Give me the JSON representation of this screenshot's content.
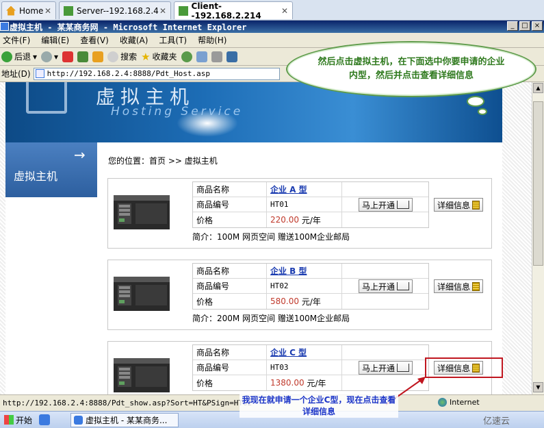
{
  "vm_tabs": [
    {
      "label": "Home",
      "active": false
    },
    {
      "label": "Server--192.168.2.4",
      "active": false
    },
    {
      "label": "Client--192.168.2.214",
      "active": true
    }
  ],
  "window": {
    "title": "虚拟主机 - 某某商务网 - Microsoft Internet Explorer",
    "buttons": [
      "_",
      "□",
      "×"
    ]
  },
  "menu": [
    "文件(F)",
    "编辑(E)",
    "查看(V)",
    "收藏(A)",
    "工具(T)",
    "帮助(H)"
  ],
  "toolbar": {
    "back": "后退",
    "search": "搜索",
    "favorites": "收藏夹"
  },
  "address": {
    "label": "地址(D)",
    "url": "http://192.168.2.4:8888/Pdt_Host.asp"
  },
  "banner": {
    "cn": "虚拟主机",
    "en": "Hosting Service"
  },
  "leftnav": {
    "arrow": "→",
    "label": "虚拟主机"
  },
  "breadcrumb": "您的位置：首页 >> 虚拟主机",
  "products": [
    {
      "k_name": "商品名称",
      "name": "企业 A 型",
      "k_code": "商品编号",
      "code": "HT01",
      "k_price": "价格",
      "price": "220.00",
      "unit": "元/年",
      "intro": "简介：100M 网页空间 赠送100M企业邮局",
      "open_label": "马上开通",
      "detail_label": "详细信息"
    },
    {
      "k_name": "商品名称",
      "name": "企业 B 型",
      "k_code": "商品编号",
      "code": "HT02",
      "k_price": "价格",
      "price": "580.00",
      "unit": "元/年",
      "intro": "简介：200M 网页空间 赠送100M企业邮局",
      "open_label": "马上开通",
      "detail_label": "详细信息"
    },
    {
      "k_name": "商品名称",
      "name": "企业 C 型",
      "k_code": "商品编号",
      "code": "HT03",
      "k_price": "价格",
      "price": "1380.00",
      "unit": "元/年",
      "intro": "",
      "open_label": "马上开通",
      "detail_label": "详细信息"
    }
  ],
  "statusbar": {
    "url": "http://192.168.2.4:8888/Pdt_show.asp?Sort=HT&PSign=HT02",
    "zone": "Internet"
  },
  "taskbar": {
    "start": "开始",
    "item": "虚拟主机 - 某某商务..."
  },
  "watermark": "亿速云",
  "callouts": {
    "top": "然后点击虚拟主机，在下面选中你要申请的企业内型，然后并点击查看详细信息",
    "bottom": "我现在就申请一个企业C型，现在点击查看详细信息"
  },
  "colors": {
    "price": "#c0392b",
    "link": "#1a3bb0",
    "callout_green": "#2f7a1e",
    "callout_blue": "#1b34c8",
    "highlight": "#c0161f"
  }
}
